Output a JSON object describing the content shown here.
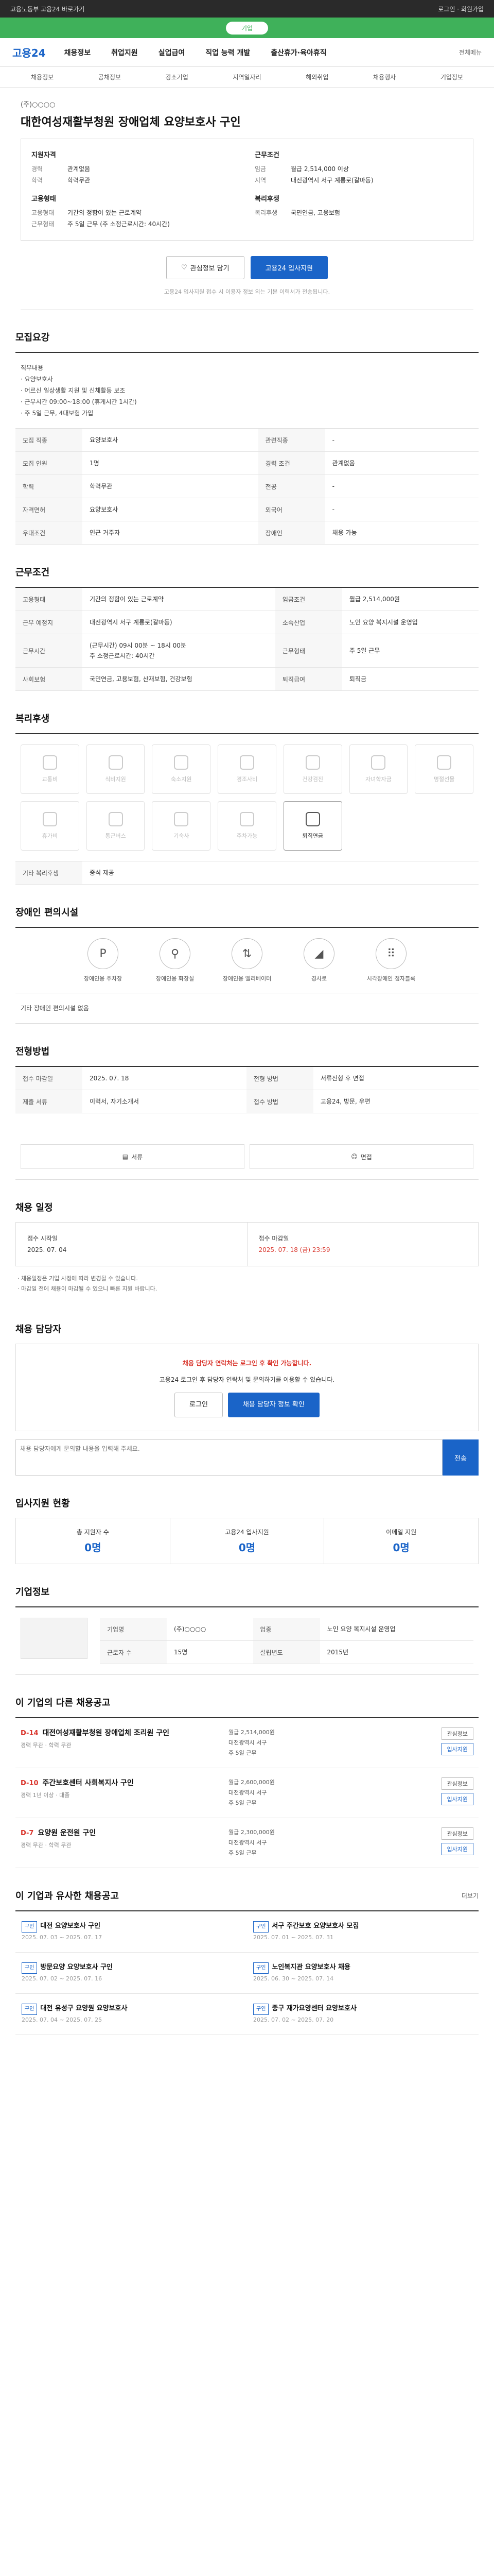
{
  "topbar": {
    "left": "고용노동부 고용24 바로가기",
    "right": "로그인 · 회원가입"
  },
  "banner": {
    "pill": "기업"
  },
  "gnb": {
    "logo": "고용24",
    "menu": [
      "채용정보",
      "취업지원",
      "실업급여",
      "직업 능력 개발",
      "출산휴가·육아휴직"
    ],
    "right": "전체메뉴"
  },
  "subnav": [
    "채용정보",
    "공채정보",
    "강소기업",
    "지역일자리",
    "해외취업",
    "채용행사",
    "기업정보"
  ],
  "job": {
    "company": "(주)○○○○",
    "title": "대한여성재활부청원 장애업체 요양보호사 구인",
    "summary_left_title": "지원자격",
    "summary_left": [
      {
        "k": "경력",
        "v": "관계없음"
      },
      {
        "k": "학력",
        "v": "학력무관"
      }
    ],
    "summary_left_title2": "고용형태",
    "summary_left2": [
      {
        "k": "고용형태",
        "v": "기간의 정함이 있는 근로계약"
      },
      {
        "k": "근무형태",
        "v": "주 5일 근무 (주 소정근로시간: 40시간)"
      }
    ],
    "summary_right_title": "근무조건",
    "summary_right": [
      {
        "k": "임금",
        "v": "월급 2,514,000 이상"
      },
      {
        "k": "지역",
        "v": "대전광역시 서구 계룡로(갈마동)"
      }
    ],
    "summary_right_title2": "복리후생",
    "summary_right2": [
      {
        "k": "복리후생",
        "v": "국민연금, 고용보험"
      }
    ]
  },
  "actions": {
    "scrap": "관심정보 담기",
    "apply": "고용24 입사지원"
  },
  "notice_line": "고용24 입사지원 접수 시 이용자 정보 외는 기본 이력서가 전송됩니다.",
  "recruit": {
    "heading": "모집요강",
    "desc": "직무내용\n· 요양보호사\n· 어르신 일상생활 지원 및 신체활동 보조\n· 근무시간 09:00~18:00 (휴게시간 1시간)\n· 주 5일 근무, 4대보험 가입",
    "rows": [
      {
        "k": "모집 직종",
        "v": "요양보호사",
        "k2": "관련직종",
        "v2": "-"
      },
      {
        "k": "모집 인원",
        "v": "1명",
        "k2": "경력 조건",
        "v2": "관계없음"
      },
      {
        "k": "학력",
        "v": "학력무관",
        "k2": "전공",
        "v2": "-"
      },
      {
        "k": "자격면허",
        "v": "요양보호사",
        "k2": "외국어",
        "v2": "-"
      },
      {
        "k": "우대조건",
        "v": "인근 거주자",
        "k2": "장애인",
        "v2": "채용 가능"
      }
    ]
  },
  "conditions": {
    "heading": "근무조건",
    "rows": [
      {
        "k": "고용형태",
        "v": "기간의 정함이 있는 근로계약",
        "k2": "임금조건",
        "v2": "월급 2,514,000원"
      },
      {
        "k": "근무 예정지",
        "v": "대전광역시 서구 계룡로(갈마동)",
        "k2": "소속산업",
        "v2": "노인 요양 복지시설 운영업"
      },
      {
        "k": "근무시간",
        "v": "(근무시간) 09시 00분 ~ 18시 00분\n주 소정근로시간: 40시간",
        "k2": "근무형태",
        "v2": "주 5일 근무"
      },
      {
        "k": "사회보험",
        "v": "국민연금, 고용보험, 산재보험, 건강보험",
        "k2": "퇴직급여",
        "v2": "퇴직금"
      }
    ]
  },
  "welfare": {
    "heading": "복리후생",
    "items": [
      {
        "label": "교통비",
        "on": false
      },
      {
        "label": "식비지원",
        "on": false
      },
      {
        "label": "숙소지원",
        "on": false
      },
      {
        "label": "경조사비",
        "on": false
      },
      {
        "label": "건강검진",
        "on": false
      },
      {
        "label": "자녀학자금",
        "on": false
      },
      {
        "label": "명절선물",
        "on": false
      },
      {
        "label": "휴가비",
        "on": false
      },
      {
        "label": "통근버스",
        "on": false
      },
      {
        "label": "기숙사",
        "on": false
      },
      {
        "label": "주차가능",
        "on": false
      },
      {
        "label": "퇴직연금",
        "on": true
      }
    ],
    "etc_label": "기타 복리후생",
    "etc_value": "중식 제공"
  },
  "disability": {
    "heading": "장애인 편의시설",
    "items": [
      "장애인용 주차장",
      "장애인용 화장실",
      "장애인용 엘리베이터",
      "경사로",
      "시각장애인 점자블록"
    ],
    "etc": "기타 장애인 편의시설 없음"
  },
  "process": {
    "heading": "전형방법",
    "items": [
      "서류",
      "면접"
    ],
    "rows": [
      {
        "k": "접수 마감일",
        "v": "2025. 07. 18"
      },
      {
        "k": "전형 방법",
        "v": "서류전형 후 면접"
      },
      {
        "k": "제출 서류",
        "v": "이력서, 자기소개서"
      },
      {
        "k": "접수 방법",
        "v": "고용24, 방문, 우편"
      }
    ]
  },
  "schedule": {
    "heading": "채용 일정",
    "start_label": "접수 시작일",
    "start": "2025. 07. 04",
    "end_label": "접수 마감일",
    "end": "2025. 07. 18 (금) 23:59",
    "bullets": "· 채용일정은 기업 사정에 따라 변경될 수 있습니다.\n· 마감일 전에 채용이 마감될 수 있으니 빠른 지원 바랍니다."
  },
  "contact": {
    "heading": "채용 담당자",
    "alert": "채용 담당자 연락처는 로그인 후 확인 가능합니다.",
    "text": "고용24 로그인 후 담당자 연락처 및 문의하기를 이용할 수 있습니다.",
    "btn1": "로그인",
    "btn2": "채용 담당자 정보 확인",
    "qa_placeholder": "채용 담당자에게 문의할 내용을 입력해 주세요.",
    "qa_send": "전송"
  },
  "stats": {
    "heading": "입사지원 현황",
    "items": [
      {
        "label": "총 지원자 수",
        "value": "0명"
      },
      {
        "label": "고용24 입사지원",
        "value": "0명"
      },
      {
        "label": "이메일 지원",
        "value": "0명"
      }
    ]
  },
  "company_info": {
    "heading": "기업정보",
    "rows": [
      {
        "k": "기업명",
        "v": "(주)○○○○"
      },
      {
        "k": "업종",
        "v": "노인 요양 복지시설 운영업"
      },
      {
        "k": "근로자 수",
        "v": "15명"
      },
      {
        "k": "설립년도",
        "v": "2015년"
      }
    ]
  },
  "other_jobs": {
    "heading": "이 기업의 다른 채용공고",
    "items": [
      {
        "dday": "D-14",
        "title": "대전여성재활부청원 장애업체 조리원 구인",
        "sub": "경력 무관 · 학력 무관",
        "meta": "월급 2,514,000원\n대전광역시 서구\n주 5일 근무"
      },
      {
        "dday": "D-10",
        "title": "주간보호센터 사회복지사 구인",
        "sub": "경력 1년 이상 · 대졸",
        "meta": "월급 2,600,000원\n대전광역시 서구\n주 5일 근무"
      },
      {
        "dday": "D-7",
        "title": "요양원 운전원 구인",
        "sub": "경력 무관 · 학력 무관",
        "meta": "월급 2,300,000원\n대전광역시 서구\n주 5일 근무"
      }
    ],
    "btn_scrap": "관심정보",
    "btn_apply": "입사지원"
  },
  "similar": {
    "heading": "이 기업과 유사한 채용공고",
    "more": "더보기",
    "items": [
      {
        "badge": "구인",
        "title": "대전 요양보호사 구인",
        "date": "2025. 07. 03 ~ 2025. 07. 17"
      },
      {
        "badge": "구인",
        "title": "서구 주간보호 요양보호사 모집",
        "date": "2025. 07. 01 ~ 2025. 07. 31"
      },
      {
        "badge": "구인",
        "title": "방문요양 요양보호사 구인",
        "date": "2025. 07. 02 ~ 2025. 07. 16"
      },
      {
        "badge": "구인",
        "title": "노인복지관 요양보호사 채용",
        "date": "2025. 06. 30 ~ 2025. 07. 14"
      },
      {
        "badge": "구인",
        "title": "대전 유성구 요양원 요양보호사",
        "date": "2025. 07. 04 ~ 2025. 07. 25"
      },
      {
        "badge": "구인",
        "title": "중구 재가요양센터 요양보호사",
        "date": "2025. 07. 02 ~ 2025. 07. 20"
      }
    ]
  }
}
